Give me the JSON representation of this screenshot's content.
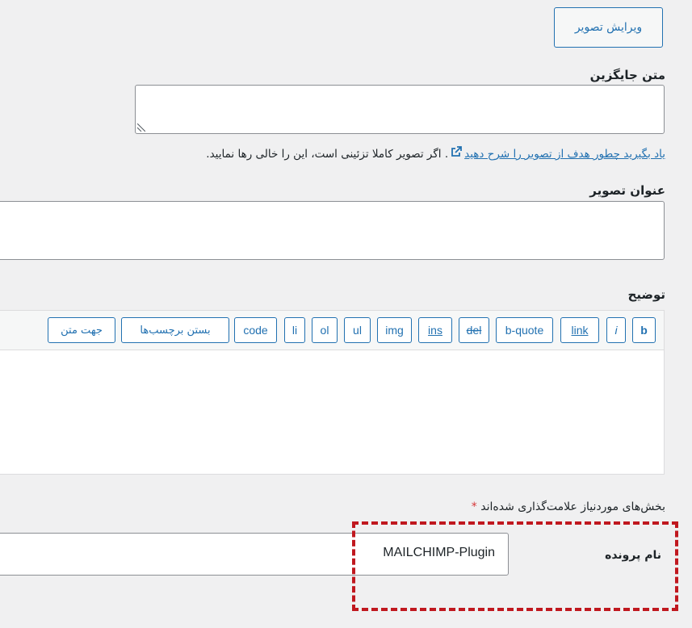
{
  "edit_image_button": "ویرایش تصویر",
  "alt_text": {
    "label": "متن جایگزین",
    "value": ""
  },
  "help_text": {
    "link": "یاد بگیرید چطور هدف از تصویر را شرح دهید",
    "rest": ". اگر تصویر کاملا تزئینی است، این را خالی رها نمایید."
  },
  "image_title": {
    "label": "عنوان تصویر",
    "value": ""
  },
  "description": {
    "label": "توضیح",
    "toolbar": {
      "b": "b",
      "i": "i",
      "link": "link",
      "b_quote": "b-quote",
      "del": "del",
      "ins": "ins",
      "img": "img",
      "ul": "ul",
      "ol": "ol",
      "li": "li",
      "code": "code",
      "close_tags": "بستن برچسب‌ها",
      "text_direction": "جهت متن"
    }
  },
  "required_note": {
    "text": "بخش‌های موردنیاز علامت‌گذاری شده‌اند",
    "star": "*"
  },
  "file_name": {
    "label": "نام پرونده",
    "value": "MAILCHIMP-Plugin"
  },
  "colors": {
    "accent": "#2271b1",
    "highlight": "#c0181f",
    "required": "#d63638"
  }
}
